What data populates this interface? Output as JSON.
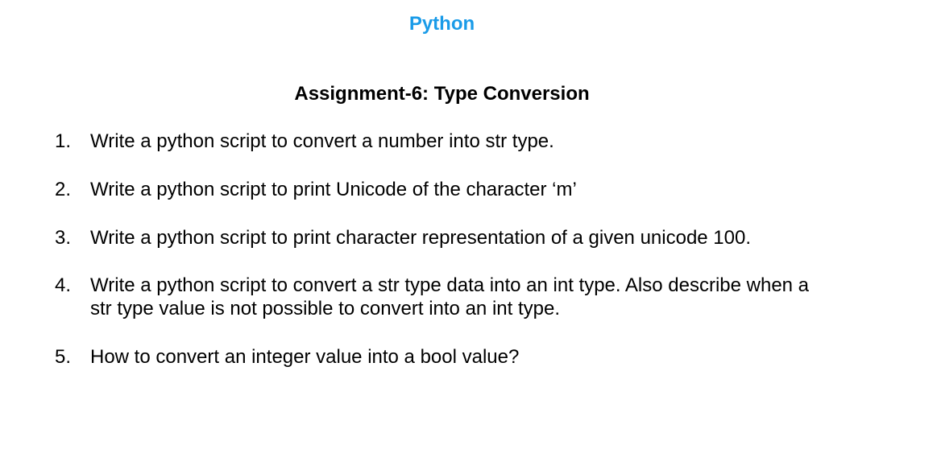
{
  "header": {
    "title": "Python",
    "title_color": "#1a9be8"
  },
  "document": {
    "title": "Assignment-6: Type Conversion"
  },
  "questions": [
    {
      "number": "1.",
      "text": "Write a python script to convert a number into str type."
    },
    {
      "number": "2.",
      "text": "Write a python script to print Unicode of the character ‘m’"
    },
    {
      "number": "3.",
      "text": "Write a python script to print character representation of a given unicode 100."
    },
    {
      "number": "4.",
      "line1": "Write a python script to convert a str type data into an int type. Also describe when a",
      "line2": "str type value is not possible to convert into an int type."
    },
    {
      "number": "5.",
      "text": "How to convert an integer value into a bool value?"
    }
  ]
}
